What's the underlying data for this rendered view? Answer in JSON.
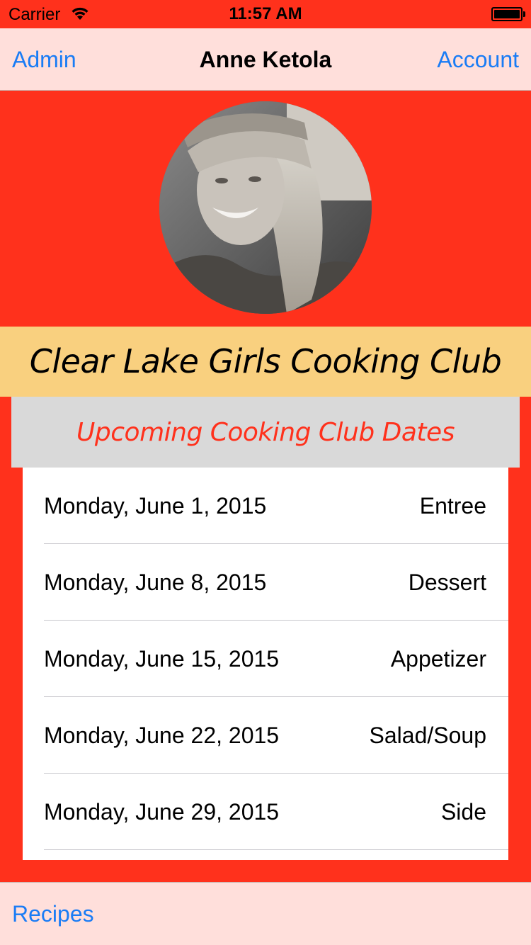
{
  "status_bar": {
    "carrier": "Carrier",
    "time": "11:57 AM"
  },
  "nav": {
    "left_label": "Admin",
    "title": "Anne Ketola",
    "right_label": "Account"
  },
  "club": {
    "name": "Clear Lake Girls Cooking Club"
  },
  "dates_section": {
    "header": "Upcoming Cooking Club Dates",
    "rows": [
      {
        "date": "Monday, June 1, 2015",
        "course": "Entree"
      },
      {
        "date": "Monday, June 8, 2015",
        "course": "Dessert"
      },
      {
        "date": "Monday, June 15, 2015",
        "course": "Appetizer"
      },
      {
        "date": "Monday, June 22, 2015",
        "course": "Salad/Soup"
      },
      {
        "date": "Monday, June 29, 2015",
        "course": "Side"
      }
    ]
  },
  "toolbar": {
    "left_label": "Recipes"
  },
  "colors": {
    "accent": "#ff311c",
    "link": "#1a7cf5",
    "bar_background": "#ffdfdb",
    "banner": "#f9d07f",
    "section_header": "#d9d9d9"
  },
  "icons": {
    "wifi": "wifi-icon",
    "battery": "battery-icon"
  }
}
